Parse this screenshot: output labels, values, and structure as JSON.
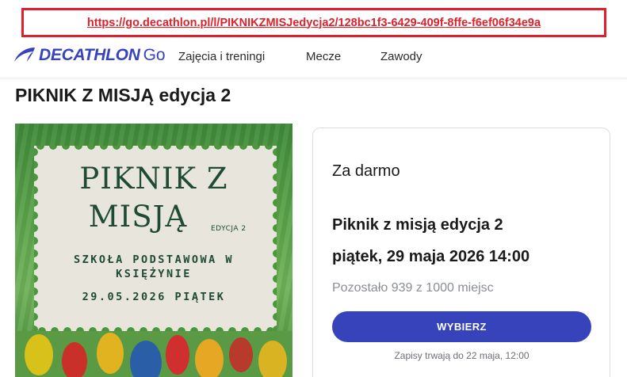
{
  "url_bar": {
    "url": "https://go.decathlon.pl/l/PIKNIKZMISJedycja2/128bc1f3-6429-409f-8ffe-f6ef06f34e9a"
  },
  "header": {
    "logo_text": "DECATHLON",
    "logo_suffix": "Go",
    "nav": [
      "Zajęcia i treningi",
      "Mecze",
      "Zawody"
    ]
  },
  "page": {
    "title": "PIKNIK Z MISJĄ edycja 2"
  },
  "poster": {
    "title_line1": "PIKNIK Z",
    "title_line2": "MISJĄ",
    "edition": "EDYCJA 2",
    "school_line1": "SZKOŁA PODSTAWOWA W",
    "school_line2": "KSIĘŻYNIE",
    "date": "29.05.2026 PIĄTEK"
  },
  "booking": {
    "price": "Za darmo",
    "event_name": "Piknik z misją edycja 2",
    "event_date": "piątek, 29 maja 2026 14:00",
    "spots": "Pozostało 939 z 1000 miejsc",
    "button_label": "WYBIERZ",
    "deadline": "Zapisy trwają do 22 maja, 12:00"
  },
  "colors": {
    "brand": "#3643ba",
    "url_highlight": "#e0202a",
    "poster_text": "#1f4b34",
    "poster_bg": "#e8e6dc"
  }
}
